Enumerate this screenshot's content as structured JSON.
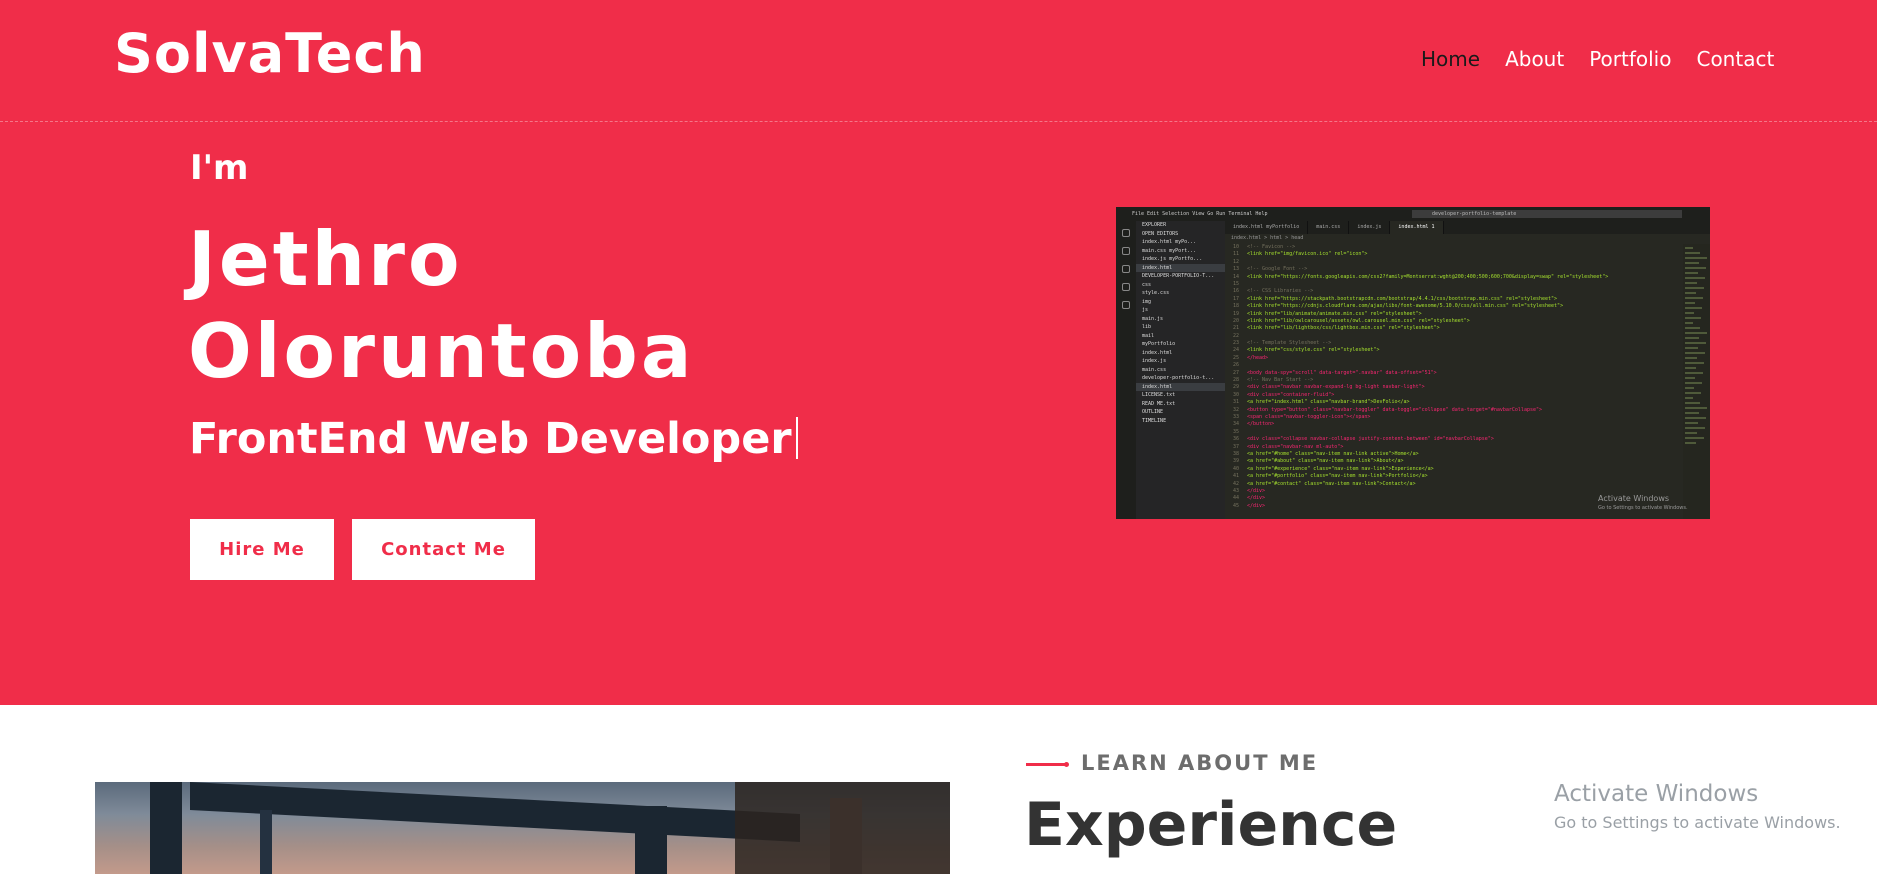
{
  "brand": "SolvaTech",
  "nav": {
    "items": [
      {
        "label": "Home"
      },
      {
        "label": "About"
      },
      {
        "label": "Portfolio"
      },
      {
        "label": "Contact"
      }
    ]
  },
  "hero": {
    "intro": "I'm",
    "name_line1": "Jethro",
    "name_line2": "Oloruntoba",
    "role": "FrontEnd Web Developer",
    "buttons": {
      "hire": "Hire Me",
      "contact": "Contact Me"
    }
  },
  "editor": {
    "menu": "File  Edit  Selection  View  Go  Run  Terminal  Help",
    "search": "developer-portfolio-template",
    "tabs": [
      "index.html myPortfolio",
      "main.css",
      "index.js",
      "index.html 1"
    ],
    "breadcrumb": "index.html > html > head",
    "explorer": [
      "EXPLORER",
      "OPEN EDITORS",
      "index.html myPo...",
      "main.css myPort...",
      "index.js myPortfo...",
      "index.html",
      "DEVELOPER-PORTFOLIO-T...",
      "css",
      "style.css",
      "img",
      "js",
      "main.js",
      "lib",
      "mail",
      "myPortfolio",
      "index.html",
      "index.js",
      "main.css",
      "developer-portfolio-t...",
      "index.html",
      "LICENSE.txt",
      "READ ME.txt",
      "OUTLINE",
      "TIMELINE"
    ],
    "lines": [
      {
        "n": "10",
        "t": "<!-- Favicon -->"
      },
      {
        "n": "11",
        "t": "<link href=\"img/favicon.ico\" rel=\"icon\">"
      },
      {
        "n": "12",
        "t": ""
      },
      {
        "n": "13",
        "t": "<!-- Google Font -->"
      },
      {
        "n": "14",
        "t": "<link href=\"https://fonts.googleapis.com/css2?family=Montserrat:wght@200;400;500;600;700&display=swap\" rel=\"stylesheet\">"
      },
      {
        "n": "15",
        "t": ""
      },
      {
        "n": "16",
        "t": "<!-- CSS Libraries -->"
      },
      {
        "n": "17",
        "t": "<link href=\"https://stackpath.bootstrapcdn.com/bootstrap/4.4.1/css/bootstrap.min.css\" rel=\"stylesheet\">"
      },
      {
        "n": "18",
        "t": "<link href=\"https://cdnjs.cloudflare.com/ajax/libs/font-awesome/5.10.0/css/all.min.css\" rel=\"stylesheet\">"
      },
      {
        "n": "19",
        "t": "<link href=\"lib/animate/animate.min.css\" rel=\"stylesheet\">"
      },
      {
        "n": "20",
        "t": "<link href=\"lib/owlcarousel/assets/owl.carousel.min.css\" rel=\"stylesheet\">"
      },
      {
        "n": "21",
        "t": "<link href=\"lib/lightbox/css/lightbox.min.css\" rel=\"stylesheet\">"
      },
      {
        "n": "22",
        "t": ""
      },
      {
        "n": "23",
        "t": "<!-- Template Stylesheet -->"
      },
      {
        "n": "24",
        "t": "<link href=\"css/style.css\" rel=\"stylesheet\">"
      },
      {
        "n": "25",
        "t": "</head>"
      },
      {
        "n": "26",
        "t": ""
      },
      {
        "n": "27",
        "t": "<body data-spy=\"scroll\" data-target=\".navbar\" data-offset=\"51\">"
      },
      {
        "n": "28",
        "t": "<!-- Nav Bar Start -->"
      },
      {
        "n": "29",
        "t": "<div class=\"navbar navbar-expand-lg bg-light navbar-light\">"
      },
      {
        "n": "30",
        "t": "<div class=\"container-fluid\">"
      },
      {
        "n": "31",
        "t": "<a href=\"index.html\" class=\"navbar-brand\">DevFolio</a>"
      },
      {
        "n": "32",
        "t": "<button type=\"button\" class=\"navbar-toggler\" data-toggle=\"collapse\" data-target=\"#navbarCollapse\">"
      },
      {
        "n": "33",
        "t": "<span class=\"navbar-toggler-icon\"></span>"
      },
      {
        "n": "34",
        "t": "</button>"
      },
      {
        "n": "35",
        "t": ""
      },
      {
        "n": "36",
        "t": "<div class=\"collapse navbar-collapse justify-content-between\" id=\"navbarCollapse\">"
      },
      {
        "n": "37",
        "t": "<div class=\"navbar-nav ml-auto\">"
      },
      {
        "n": "38",
        "t": "<a href=\"#home\" class=\"nav-item nav-link active\">Home</a>"
      },
      {
        "n": "39",
        "t": "<a href=\"#about\" class=\"nav-item nav-link\">About</a>"
      },
      {
        "n": "40",
        "t": "<a href=\"#experience\" class=\"nav-item nav-link\">Experience</a>"
      },
      {
        "n": "41",
        "t": "<a href=\"#portfolio\" class=\"nav-item nav-link\">Portfolio</a>"
      },
      {
        "n": "42",
        "t": "<a href=\"#contact\" class=\"nav-item nav-link\">Contact</a>"
      },
      {
        "n": "43",
        "t": "</div>"
      },
      {
        "n": "44",
        "t": "</div>"
      },
      {
        "n": "45",
        "t": "</div>"
      }
    ],
    "watermark1": "Activate Windows",
    "watermark2": "Go to Settings to activate Windows."
  },
  "about": {
    "kicker": "LEARN ABOUT ME",
    "title": "Experience"
  },
  "windows_watermark": {
    "line1": "Activate Windows",
    "line2": "Go to Settings to activate Windows."
  },
  "colors": {
    "accent": "#f02d49",
    "heading": "#333333"
  }
}
